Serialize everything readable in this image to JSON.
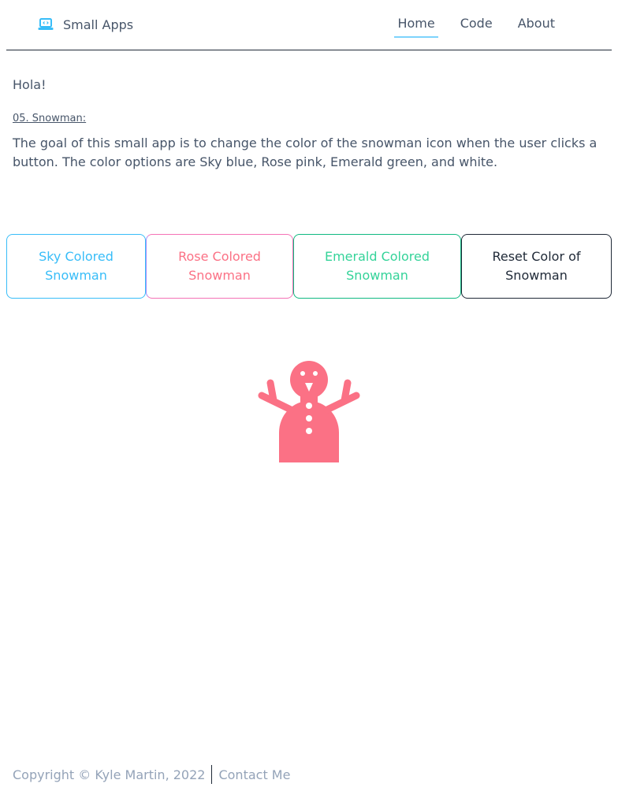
{
  "nav": {
    "brand_label": "Small Apps",
    "brand_icon": "laptop-code-icon",
    "links": [
      "Home",
      "Code",
      "About"
    ],
    "active": "Home",
    "accent": "#7dd3fc"
  },
  "main": {
    "greeting": "Hola!",
    "section_title": "05. Snowman:",
    "description": "The goal of this small app is to change the color of the snowman icon when the user clicks a button. The color options are Sky blue, Rose pink, Emerald green, and white."
  },
  "buttons": {
    "sky": "Sky Colored Snowman",
    "rose": "Rose Colored Snowman",
    "emerald": "Emerald Colored Snowman",
    "reset": "Reset Color of Snowman"
  },
  "snowman": {
    "icon": "snowman-icon",
    "color": "#fb7185"
  },
  "footer": {
    "copyright": "Copyright © Kyle Martin, 2022",
    "contact": "Contact Me"
  }
}
